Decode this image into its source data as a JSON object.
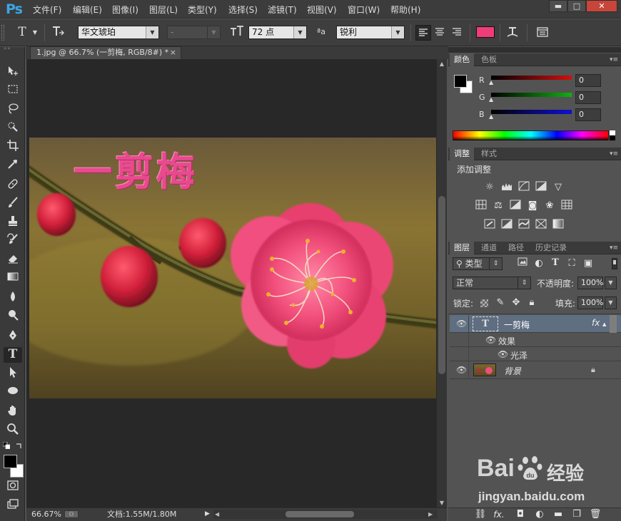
{
  "app": {
    "logo": "Ps"
  },
  "menus": [
    "文件(F)",
    "编辑(E)",
    "图像(I)",
    "图层(L)",
    "类型(Y)",
    "选择(S)",
    "滤镜(T)",
    "视图(V)",
    "窗口(W)",
    "帮助(H)"
  ],
  "window_controls": {
    "minimize": "▬",
    "maximize": "□",
    "close": "✕"
  },
  "options": {
    "type_tool_glyph": "T",
    "font_family": "华文琥珀",
    "font_style": "-",
    "font_size": "72 点",
    "aa_label": "ªa",
    "anti_alias": "锐利",
    "text_color": "#f03c78"
  },
  "document": {
    "tab_title": "1.jpg @ 66.7% (一剪梅, RGB/8#) *",
    "close_glyph": "×",
    "canvas_text": "一剪梅",
    "canvas_text_color": "#e84a8e"
  },
  "status": {
    "zoom": "66.67%",
    "doc_info": "文档:1.55M/1.80M"
  },
  "color_panel": {
    "tabs": [
      "颜色",
      "色板"
    ],
    "channels": [
      {
        "label": "R",
        "value": "0",
        "color": "#d01010"
      },
      {
        "label": "G",
        "value": "0",
        "color": "#10b010"
      },
      {
        "label": "B",
        "value": "0",
        "color": "#1010d0"
      }
    ]
  },
  "adjust_panel": {
    "tabs": [
      "调整",
      "样式"
    ],
    "title": "添加调整"
  },
  "layers_panel": {
    "tabs": [
      "图层",
      "通道",
      "路径",
      "历史记录"
    ],
    "filter_kind": "类型",
    "blend_mode": "正常",
    "opacity_label": "不透明度:",
    "opacity": "100%",
    "lock_label": "锁定:",
    "fill_label": "填充:",
    "fill": "100%",
    "layers": [
      {
        "name": "一剪梅",
        "fx": "fx",
        "effects_label": "效果",
        "effect": "光泽"
      },
      {
        "name": "背景"
      }
    ]
  },
  "watermark": {
    "brand": "Bai",
    "brand2": "du",
    "cn": "经验",
    "url": "jingyan.baidu.com"
  }
}
